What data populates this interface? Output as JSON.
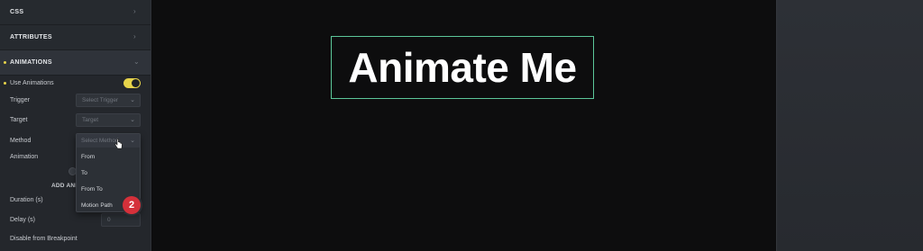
{
  "sidebar": {
    "sections": [
      {
        "label": "CSS"
      },
      {
        "label": "ATTRIBUTES"
      },
      {
        "label": "ANIMATIONS"
      }
    ],
    "use_animations_label": "Use Animations",
    "use_animations_on": true,
    "fields": {
      "trigger": {
        "label": "Trigger",
        "placeholder": "Select Trigger"
      },
      "target": {
        "label": "Target",
        "placeholder": "Target"
      },
      "method": {
        "label": "Method",
        "placeholder": "Select Method"
      },
      "animation_label": "Animation",
      "duration_label": "Duration (s)",
      "delay_label": "Delay (s)",
      "delay_value": "0",
      "disable_label": "Disable from Breakpoint"
    },
    "add_animation_label": "ADD ANI",
    "method_dropdown": {
      "options": [
        "From",
        "To",
        "From To",
        "Motion Path"
      ]
    },
    "step_badge": "2"
  },
  "canvas": {
    "heading": "Animate Me"
  },
  "colors": {
    "accent": "#e6d34a",
    "selection": "#5cc79a",
    "badge": "#d5303a"
  }
}
